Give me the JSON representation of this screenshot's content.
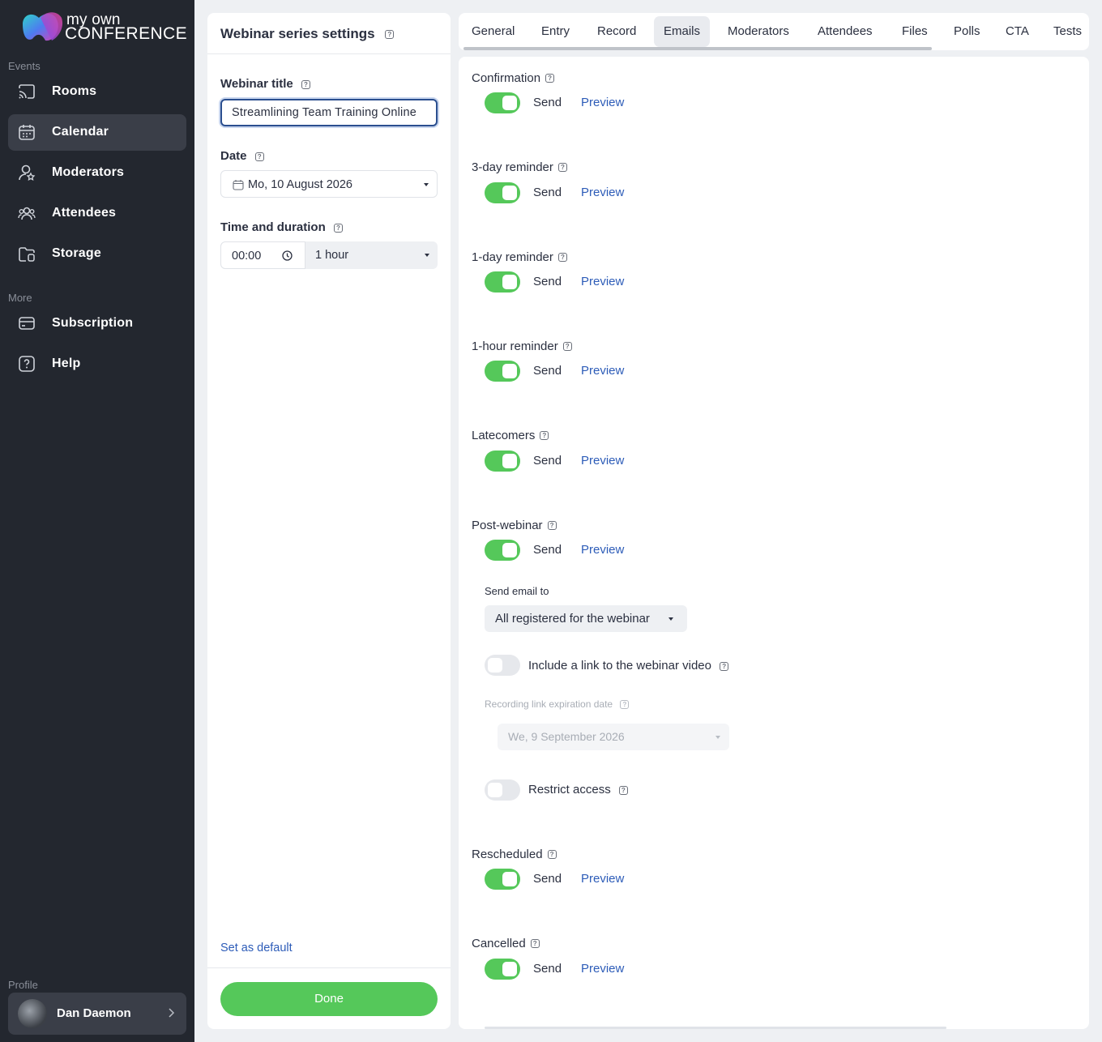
{
  "app": {
    "logo_line1": "my own",
    "logo_line2": "CONFERENCE"
  },
  "sidebar": {
    "events_label": "Events",
    "more_label": "More",
    "profile_label": "Profile",
    "items": [
      {
        "label": "Rooms",
        "icon": "cast-icon"
      },
      {
        "label": "Calendar",
        "icon": "calendar-icon",
        "active": true
      },
      {
        "label": "Moderators",
        "icon": "user-star-icon"
      },
      {
        "label": "Attendees",
        "icon": "users-icon"
      },
      {
        "label": "Storage",
        "icon": "folder-icon"
      },
      {
        "label": "Subscription",
        "icon": "card-icon"
      },
      {
        "label": "Help",
        "icon": "question-icon"
      }
    ],
    "user_name": "Dan Daemon"
  },
  "settings": {
    "title": "Webinar series settings",
    "webinar_title_label": "Webinar title",
    "webinar_title_value": "Streamlining Team Training Online",
    "date_label": "Date",
    "date_value": "Mo, 10 August 2026",
    "time_label": "Time and duration",
    "time_value": "00:00",
    "duration_value": "1 hour",
    "set_default": "Set as default",
    "done": "Done"
  },
  "tabs": [
    "General",
    "Entry",
    "Record",
    "Emails",
    "Moderators",
    "Attendees",
    "Files",
    "Polls",
    "CTA",
    "Tests"
  ],
  "active_tab": "Emails",
  "emails": {
    "send_label": "Send",
    "preview_label": "Preview",
    "sections": [
      {
        "title": "Confirmation",
        "enabled": true
      },
      {
        "title": "3-day reminder",
        "enabled": true
      },
      {
        "title": "1-day reminder",
        "enabled": true
      },
      {
        "title": "1-hour reminder",
        "enabled": true
      },
      {
        "title": "Latecomers",
        "enabled": true
      },
      {
        "title": "Post-webinar",
        "enabled": true
      },
      {
        "title": "Rescheduled",
        "enabled": true
      },
      {
        "title": "Cancelled",
        "enabled": true
      }
    ],
    "post_webinar": {
      "send_to_label": "Send email to",
      "send_to_value": "All registered for the webinar",
      "include_link_label": "Include a link to the webinar video",
      "include_link_enabled": false,
      "expiration_label": "Recording link expiration date",
      "expiration_value": "We, 9 September 2026",
      "restrict_label": "Restrict access",
      "restrict_enabled": false
    }
  },
  "colors": {
    "sidebar_bg": "#23272f",
    "accent_green": "#55c85a",
    "link_blue": "#2d5cb8"
  }
}
